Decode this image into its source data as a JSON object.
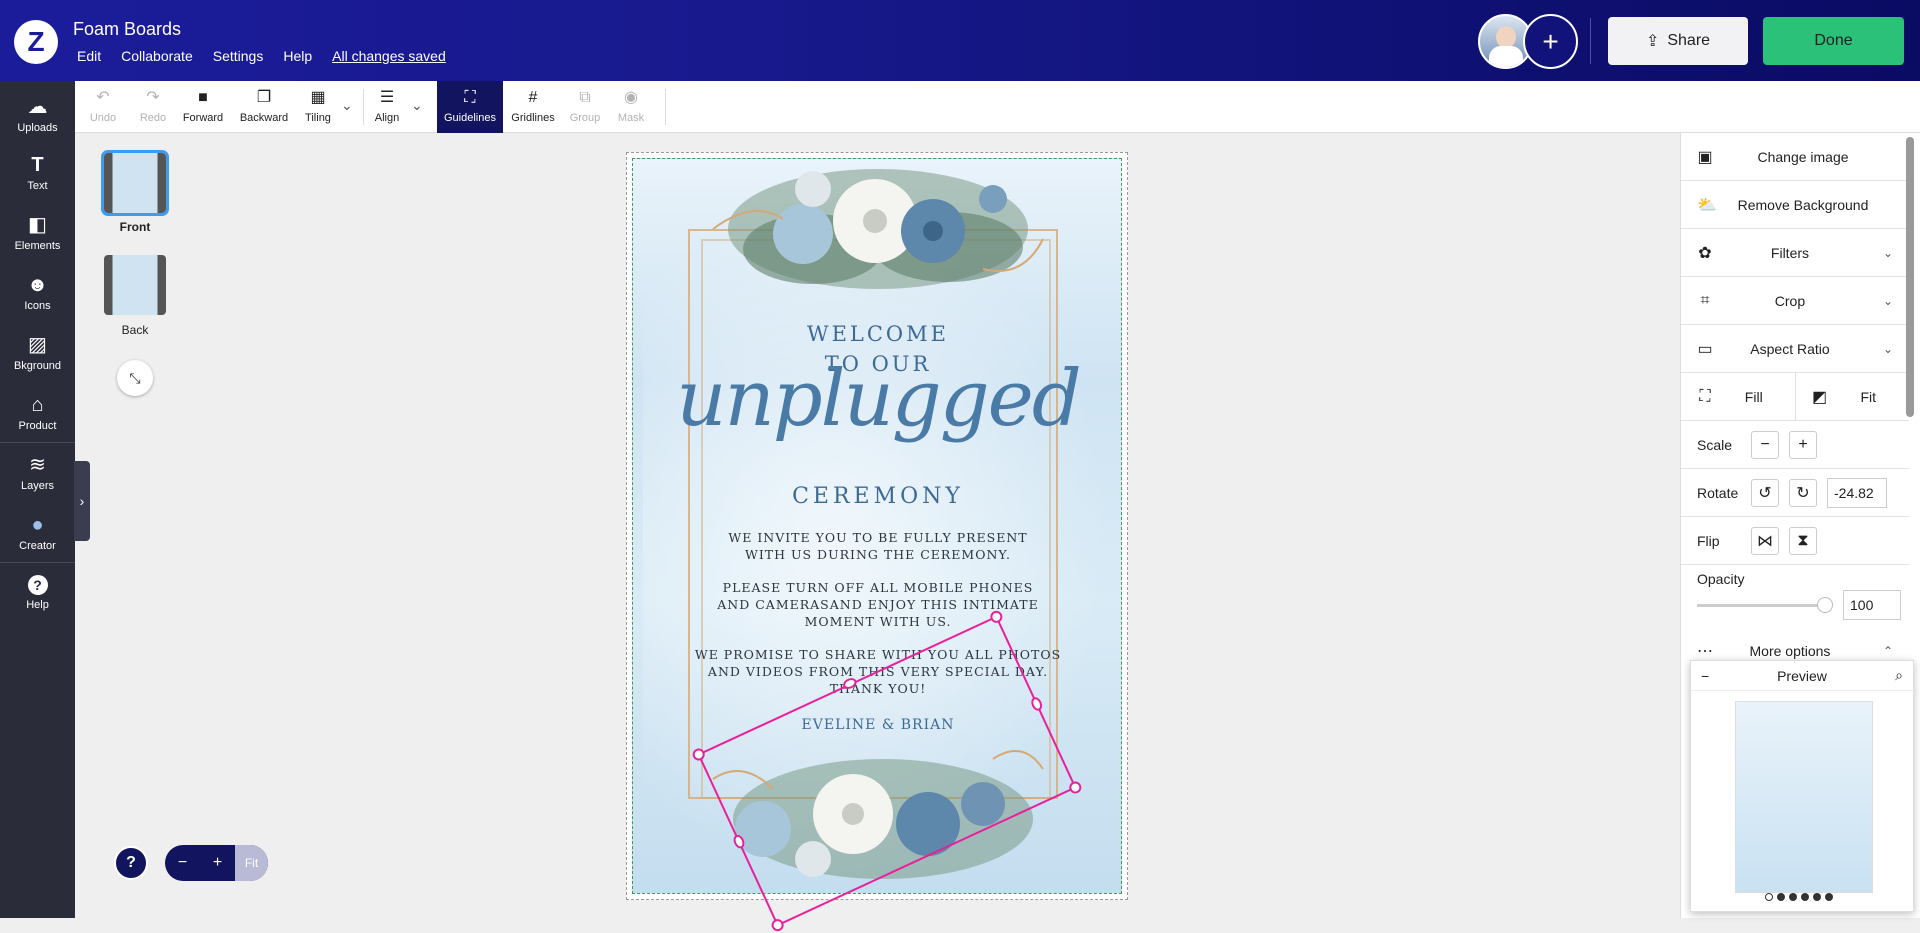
{
  "header": {
    "logo": "Z",
    "title": "Foam Boards",
    "menu": [
      "Edit",
      "Collaborate",
      "Settings",
      "Help"
    ],
    "saved_status": "All changes saved",
    "add_collaborator": "+",
    "share_label": "Share",
    "done_label": "Done",
    "brand_color": "#1b1c9a",
    "done_color": "#2bc178"
  },
  "leftnav": {
    "items": [
      {
        "label": "Uploads",
        "icon": "☁"
      },
      {
        "label": "Text",
        "icon": "T"
      },
      {
        "label": "Elements",
        "icon": "◧"
      },
      {
        "label": "Icons",
        "icon": "☻"
      },
      {
        "label": "Bkground",
        "icon": "▨"
      },
      {
        "label": "Product",
        "icon": "⌂"
      },
      {
        "label": "Layers",
        "icon": "≋"
      },
      {
        "label": "Creator",
        "icon": "●"
      },
      {
        "label": "Help",
        "icon": "?"
      }
    ]
  },
  "toolbar": {
    "undo": "Undo",
    "redo": "Redo",
    "forward": "Forward",
    "backward": "Backward",
    "tiling": "Tiling",
    "align": "Align",
    "guidelines": "Guidelines",
    "gridlines": "Gridlines",
    "group": "Group",
    "mask": "Mask"
  },
  "pages": {
    "front": "Front",
    "back": "Back"
  },
  "zoom": {
    "help": "?",
    "minus": "−",
    "plus": "+",
    "fit": "Fit"
  },
  "design": {
    "welcome_line1": "WELCOME",
    "welcome_line2": "TO OUR",
    "script": "unplugged",
    "ceremony": "CEREMONY",
    "p1_line1": "WE INVITE YOU TO BE FULLY PRESENT",
    "p1_line2": "WITH US DURING THE CEREMONY.",
    "p2_line1": "PLEASE TURN OFF ALL MOBILE PHONES",
    "p2_line2": "AND CAMERASAND ENJOY THIS INTIMATE",
    "p2_line3": "MOMENT WITH US.",
    "p3_line1": "WE PROMISE TO SHARE WITH YOU ALL PHOTOS",
    "p3_line2": "AND VIDEOS FROM THIS VERY SPECIAL DAY.",
    "p3_line3": "THANK YOU!",
    "names": "EVELINE & BRIAN"
  },
  "rightpanel": {
    "change_image": "Change image",
    "remove_bg": "Remove Background",
    "filters": "Filters",
    "crop": "Crop",
    "aspect_ratio": "Aspect Ratio",
    "fill": "Fill",
    "fit": "Fit",
    "scale": "Scale",
    "rotate": "Rotate",
    "rotate_value": "-24.82",
    "flip": "Flip",
    "opacity": "Opacity",
    "opacity_value": "100",
    "more_options": "More options"
  },
  "preview": {
    "title": "Preview",
    "minimize": "−"
  }
}
